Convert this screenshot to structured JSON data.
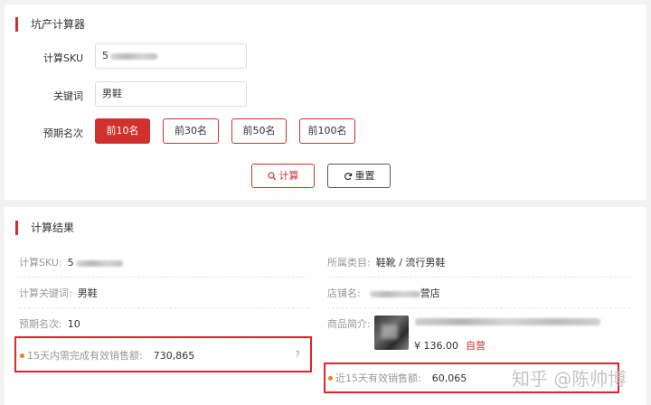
{
  "calculator": {
    "title": "坑产计算器",
    "sku_label": "计算SKU",
    "sku_value": "5",
    "keyword_label": "关键词",
    "keyword_value": "男鞋",
    "rank_label": "预期名次",
    "rank_options": [
      "前10名",
      "前30名",
      "前50名",
      "前100名"
    ],
    "rank_selected": "前10名",
    "calc_label": "计算",
    "reset_label": "重置"
  },
  "result": {
    "title": "计算结果",
    "sku_label": "计算SKU:",
    "sku_value": "5",
    "keyword_label": "计算关键词:",
    "keyword_value": "男鞋",
    "rank_label": "预期名次:",
    "rank_value": "10",
    "needed_sales_label": "15天内需完成有效销售额:",
    "needed_sales_value": "730,865",
    "help_mark": "?",
    "category_label": "所属类目:",
    "category_value": "鞋靴 / 流行男鞋",
    "shop_label": "店铺名:",
    "shop_suffix": "营店",
    "product_label": "商品简介:",
    "product_price": "¥ 136.00",
    "product_tag": "自营",
    "recent_sales_label": "近15天有效销售额:",
    "recent_sales_value": "60,065"
  },
  "watermark": "知乎 @陈帅博",
  "colors": {
    "accent": "#d0312d",
    "highlight_box": "#e3232c",
    "bullet": "#e8832a"
  }
}
